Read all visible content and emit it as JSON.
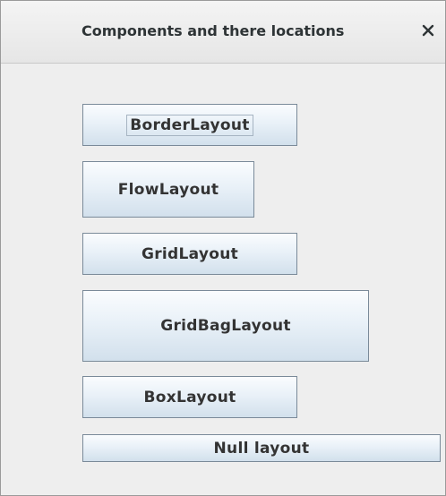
{
  "window": {
    "title": "Components and there locations",
    "close_icon": "close-icon"
  },
  "buttons": {
    "border_layout": "BorderLayout",
    "flow_layout": "FlowLayout",
    "grid_layout": "GridLayout",
    "gridbag_layout": "GridBagLayout",
    "box_layout": "BoxLayout",
    "null_layout": "Null layout"
  },
  "colors": {
    "button_border": "#7a8a99",
    "button_gradient_top": "#fafcfe",
    "button_gradient_bottom": "#d2e0ec",
    "background": "#eeeeee"
  }
}
